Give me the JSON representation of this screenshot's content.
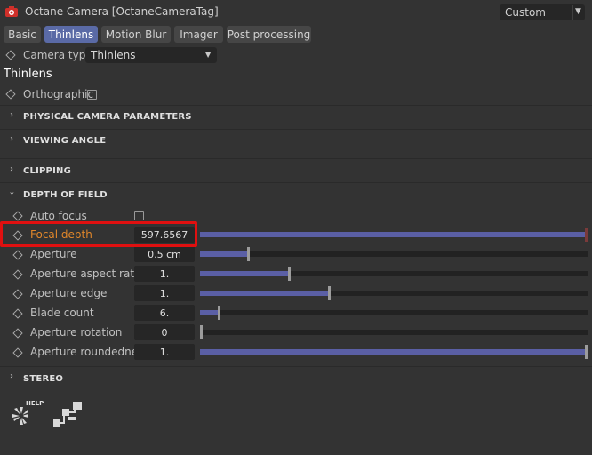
{
  "header": {
    "title": "Octane Camera [OctaneCameraTag]",
    "preset": "Custom"
  },
  "tabs": [
    {
      "label": "Basic",
      "active": false
    },
    {
      "label": "Thinlens",
      "active": true
    },
    {
      "label": "Motion Blur",
      "active": false
    },
    {
      "label": "Imager",
      "active": false
    },
    {
      "label": "Post processing",
      "active": false
    }
  ],
  "camera_type": {
    "label": "Camera type",
    "value": "Thinlens"
  },
  "section_title": "Thinlens",
  "orthographic": {
    "label": "Orthographic",
    "checked": false
  },
  "groups": {
    "physical": "PHYSICAL CAMERA PARAMETERS",
    "viewing": "VIEWING ANGLE",
    "clipping": "CLIPPING",
    "dof": "DEPTH OF FIELD",
    "stereo": "STEREO"
  },
  "dof": {
    "auto_focus": {
      "label": "Auto focus",
      "checked": false
    },
    "params": [
      {
        "label": "Focal depth",
        "value": "597.6567",
        "slider_fraction": 1.0
      },
      {
        "label": "Aperture",
        "value": "0.5 cm",
        "slider_fraction": 0.125
      },
      {
        "label": "Aperture aspect ratio",
        "value": "1.",
        "slider_fraction": 0.23
      },
      {
        "label": "Aperture edge",
        "value": "1.",
        "slider_fraction": 0.333
      },
      {
        "label": "Blade count",
        "value": "6.",
        "slider_fraction": 0.05
      },
      {
        "label": "Aperture rotation",
        "value": "0",
        "slider_fraction": 0.0
      },
      {
        "label": "Aperture roundedness",
        "value": "1.",
        "slider_fraction": 1.0
      }
    ]
  },
  "footer": {
    "help_label": "HELP"
  },
  "colors": {
    "accent": "#5a6aa6",
    "slider_fill": "#5a5fa5",
    "highlight": "#e01010",
    "focal_label": "#e0862a"
  }
}
